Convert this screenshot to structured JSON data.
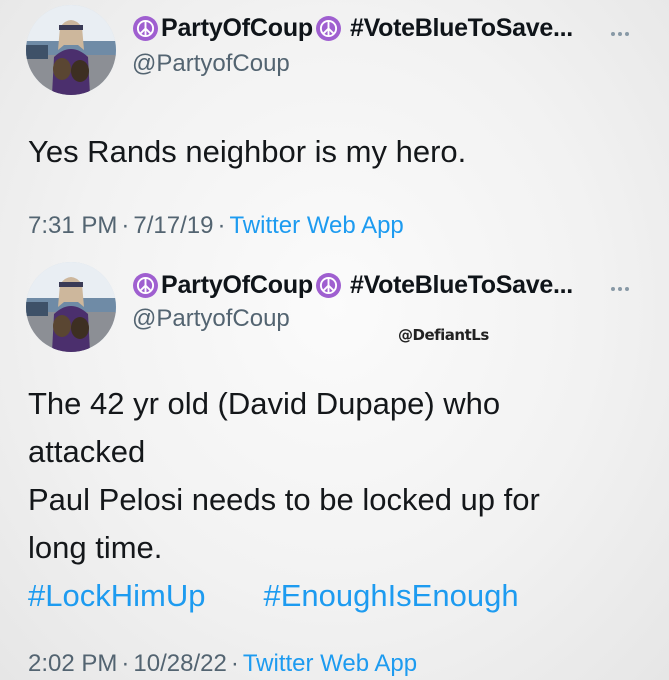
{
  "tweets": [
    {
      "display_name": "PartyOfCoup",
      "name_suffix": "#VoteBlueToSave...",
      "handle": "@PartyofCoup",
      "text_lines": [
        "Yes Rands neighbor is my hero."
      ],
      "hashtags": [],
      "time": "7:31 PM",
      "date": "7/17/19",
      "source": "Twitter Web App"
    },
    {
      "display_name": "PartyOfCoup",
      "name_suffix": "#VoteBlueToSave...",
      "handle": "@PartyofCoup",
      "text_lines": [
        "The 42 yr old (David Dupape) who",
        "attacked",
        "Paul Pelosi needs to be locked up for",
        "long time."
      ],
      "hashtags": [
        "#LockHimUp",
        "#EnoughIsEnough"
      ],
      "time": "2:02 PM",
      "date": "10/28/22",
      "source": "Twitter Web App"
    }
  ],
  "watermark": "@DefiantLs",
  "separator": "·",
  "colors": {
    "link": "#1d9bf0",
    "secondary_text": "#536471",
    "peace_emoji_bg": "#9f5fd0"
  },
  "icons": [
    "peace-symbol-icon",
    "more-options-icon"
  ]
}
